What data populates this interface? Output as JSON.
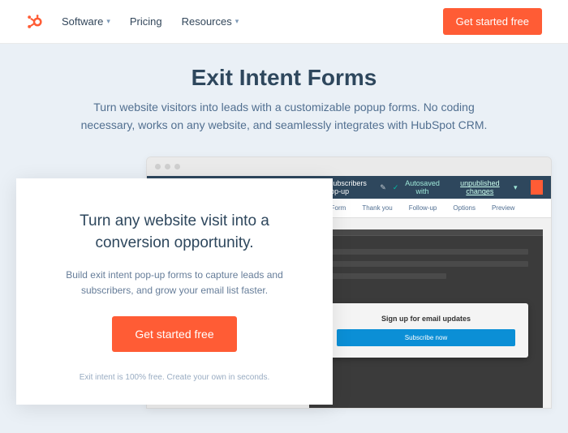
{
  "nav": {
    "items": [
      "Software",
      "Pricing",
      "Resources"
    ],
    "cta": "Get started free"
  },
  "hero": {
    "title": "Exit Intent Forms",
    "subtitle": "Turn website visitors into leads with a customizable popup forms. No coding necessary, works on any website, and seamlessly integrates with HubSpot CRM."
  },
  "window": {
    "title_label": "Email Subscribers Pop-up",
    "autosave_prefix": "Autosaved with",
    "autosave_link": "unpublished changes",
    "tabs": [
      "ut",
      "Form",
      "Thank you",
      "Follow-up",
      "Options",
      "Preview"
    ]
  },
  "popup": {
    "title": "Sign up for email updates",
    "button": "Subscribe now"
  },
  "card": {
    "heading": "Turn any website visit into a conversion opportunity.",
    "body": "Build exit intent pop-up forms to capture leads and subscribers, and grow your email list faster.",
    "cta": "Get started free",
    "fineprint": "Exit intent is 100% free. Create your own in seconds."
  }
}
